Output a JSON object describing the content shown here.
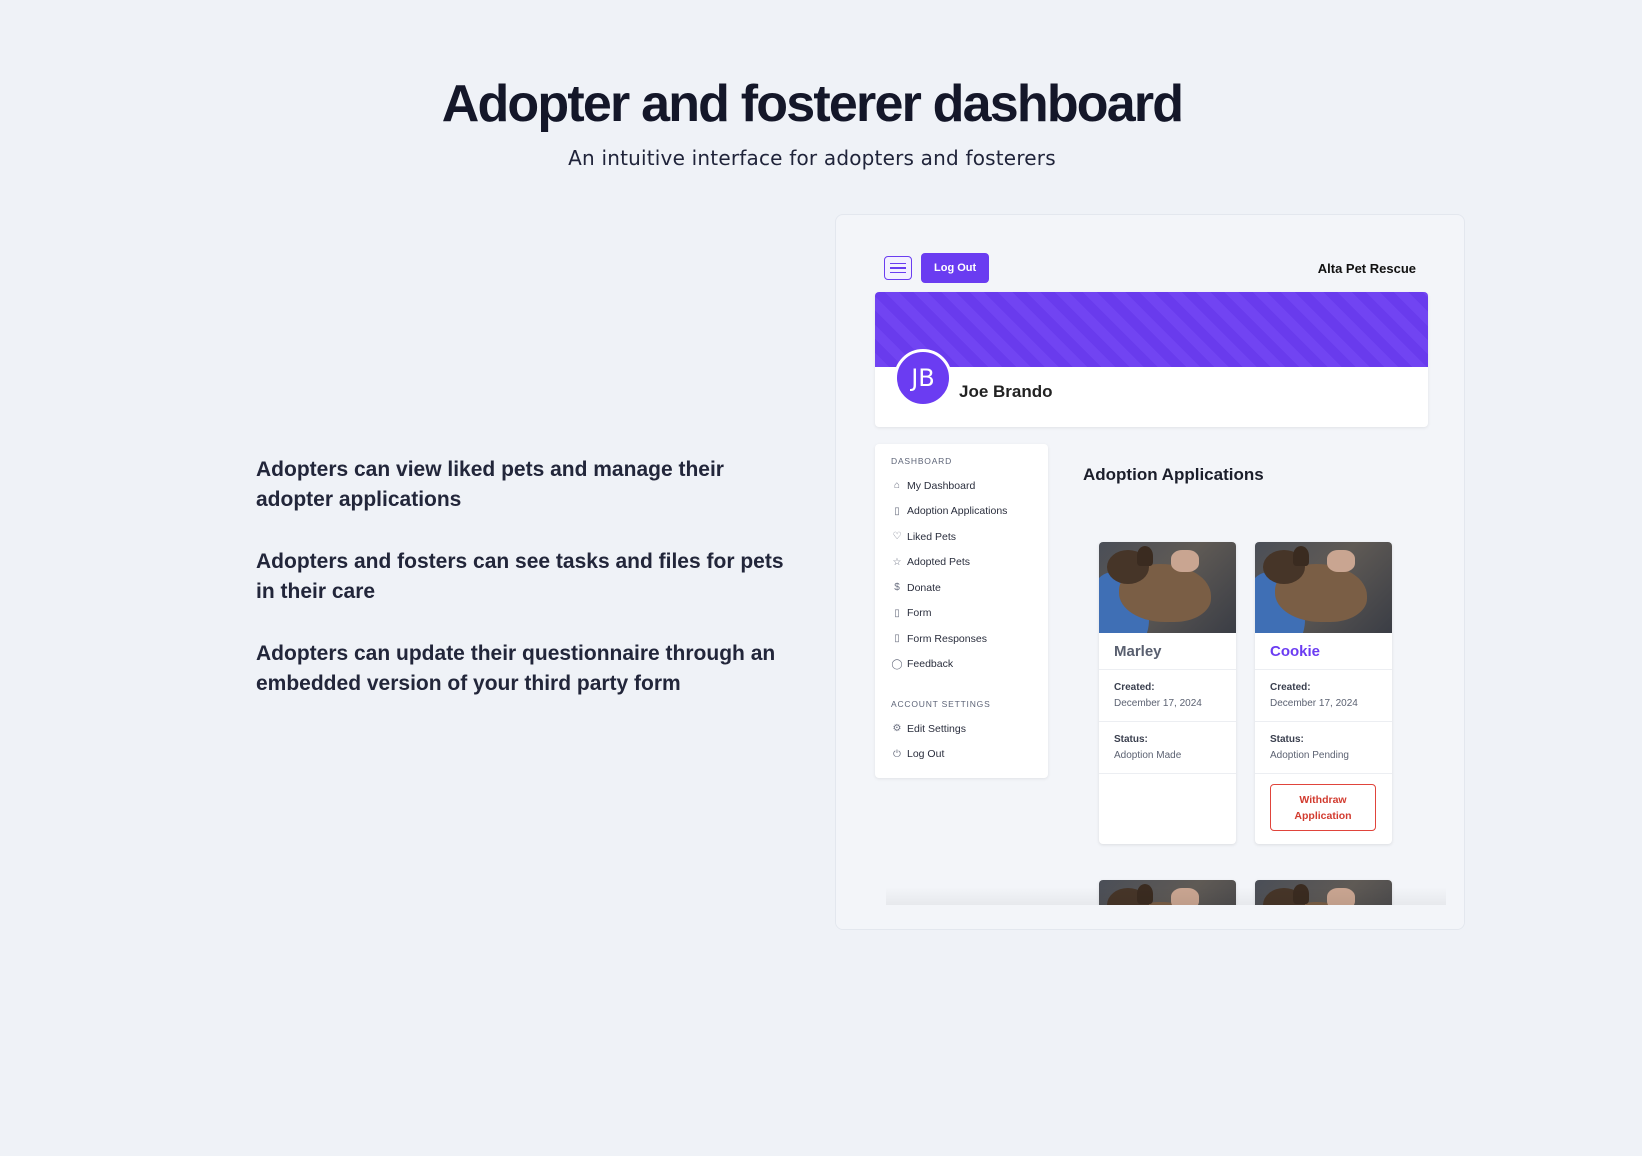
{
  "hero": {
    "title": "Adopter and fosterer dashboard",
    "subtitle": "An intuitive interface for adopters and fosterers"
  },
  "features": [
    "Adopters can view liked pets and manage their adopter applications",
    "Adopters and fosters can see tasks and files for pets in their care",
    "Adopters can update their questionnaire through an embedded version of your third party form"
  ],
  "app": {
    "topbar": {
      "menu_icon": "hamburger-icon",
      "logout_label": "Log Out",
      "org_name": "Alta Pet Rescue"
    },
    "profile": {
      "initials": "JB",
      "name": "Joe Brando",
      "accent": "#6b3cf2"
    },
    "nav": {
      "dashboard_heading": "DASHBOARD",
      "items": [
        {
          "label": "My Dashboard",
          "icon": "home-icon"
        },
        {
          "label": "Adoption Applications",
          "icon": "book-icon"
        },
        {
          "label": "Liked Pets",
          "icon": "heart-icon"
        },
        {
          "label": "Adopted Pets",
          "icon": "star-icon"
        },
        {
          "label": "Donate",
          "icon": "dollar-icon"
        },
        {
          "label": "Form",
          "icon": "clipboard-icon"
        },
        {
          "label": "Form Responses",
          "icon": "clipboard-icon"
        },
        {
          "label": "Feedback",
          "icon": "chat-icon"
        }
      ],
      "account_heading": "ACCOUNT SETTINGS",
      "account_items": [
        {
          "label": "Edit Settings",
          "icon": "gear-icon"
        },
        {
          "label": "Log Out",
          "icon": "power-icon"
        }
      ]
    },
    "section_title": "Adoption Applications",
    "applications": [
      {
        "pet": "Marley",
        "created_label": "Created:",
        "created": "December 17, 2024",
        "status_label": "Status:",
        "status": "Adoption Made",
        "name_color": "#5a6070"
      },
      {
        "pet": "Cookie",
        "created_label": "Created:",
        "created": "December 17, 2024",
        "status_label": "Status:",
        "status": "Adoption Pending",
        "name_color": "#6b3cf2",
        "action": "Withdraw Application"
      }
    ]
  }
}
